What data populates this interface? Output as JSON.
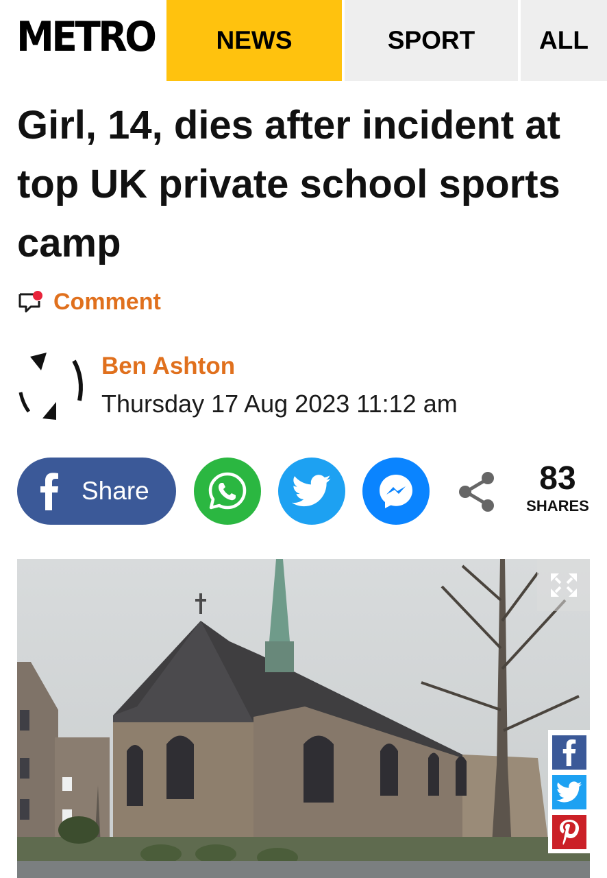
{
  "header": {
    "logo": "METRO",
    "tabs": [
      {
        "label": "NEWS",
        "active": true
      },
      {
        "label": "SPORT",
        "active": false
      },
      {
        "label": "ALL",
        "active": false
      }
    ]
  },
  "article": {
    "headline": "Girl, 14, dies after incident at top UK private school sports camp",
    "comment_label": "Comment",
    "author": "Ben Ashton",
    "date": "Thursday 17 Aug 2023 11:12 am"
  },
  "share": {
    "facebook_label": "Share",
    "count": "83",
    "count_label": "SHARES",
    "icons": [
      "facebook-icon",
      "whatsapp-icon",
      "twitter-icon",
      "messenger-icon",
      "share-icon"
    ]
  },
  "image": {
    "subject": "stone-church-photo",
    "side_share_icons": [
      "facebook-icon",
      "twitter-icon",
      "pinterest-icon"
    ]
  },
  "colors": {
    "accent_yellow": "#ffc20e",
    "author_orange": "#e0701d",
    "facebook": "#3b5998",
    "whatsapp": "#2bb741",
    "twitter": "#1da1f2",
    "messenger": "#0a84ff",
    "pinterest": "#cb2027"
  }
}
